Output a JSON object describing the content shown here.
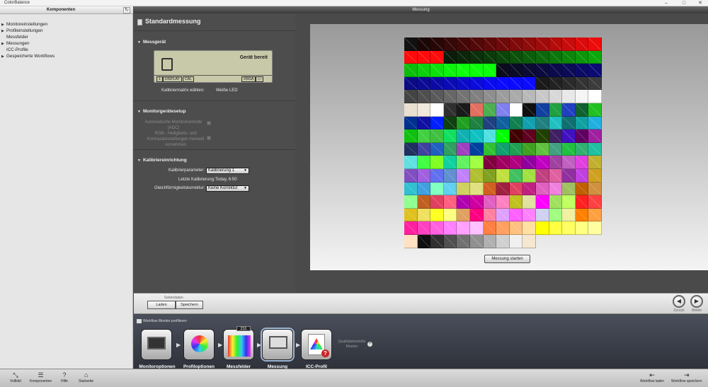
{
  "app": {
    "title": "ColorBalance"
  },
  "window_controls": {
    "minimize": "–",
    "maximize": "□",
    "close": "✕"
  },
  "sidebar": {
    "header": "Komponenten",
    "refresh_icon": "↻",
    "items": [
      {
        "label": "Monitoreinstellungen",
        "expandable": true
      },
      {
        "label": "Profileinstellungen",
        "expandable": true
      },
      {
        "label": "Messfelder",
        "expandable": false
      },
      {
        "label": "Messungen",
        "expandable": true
      },
      {
        "label": "ICC-Profile",
        "expandable": false
      },
      {
        "label": "Gespeicherte Workflows",
        "expandable": true
      }
    ]
  },
  "main": {
    "strip_title": "Messung"
  },
  "panel": {
    "title": "Standardmessung",
    "messgeraet": {
      "header": "Messgerät",
      "lcd_status": "Gerät bereit",
      "lcd_tags": [
        "1",
        "DISPLAY",
        "CAL",
        "XRGA",
        "▭"
      ],
      "matrix_label": "Kalibriermatrix wählen:",
      "matrix_value": "Weiße LED"
    },
    "setup": {
      "header": "Monitorgerätesetup",
      "auto_label": "Automatische Monitorkontrolle (ADC)",
      "rgb_label": "RGB-, Helligkeits- und Kontrasteinstellungen manuell vornehmen"
    },
    "calib": {
      "header": "Kalibriereinrichtung",
      "param_label": "Kalibrierparameter:",
      "param_value": "Kalibrierung 1",
      "last_label": "Letzte Kalibrierung:",
      "last_value": "Today, 6:50",
      "uniform_label": "Gleichförmigkeitskorrektur:",
      "uniform_value": "Keine Korrektur"
    }
  },
  "preview": {
    "start_button": "Messung starten",
    "patches": [
      "#111111",
      "#1c0707",
      "#280707",
      "#360808",
      "#440808",
      "#520909",
      "#600909",
      "#700a0a",
      "#800a0a",
      "#900b0b",
      "#a00b0b",
      "#b40b0b",
      "#c80b0b",
      "#dc0b0b",
      "#ee0b0b",
      "#ff0b0b",
      "#ff0b0b",
      "#ff0b0b",
      "#0b1c0b",
      "#0b260b",
      "#0b300b",
      "#0b3a0b",
      "#0b440b",
      "#0b500b",
      "#0b5c0b",
      "#0b680b",
      "#0b760b",
      "#0b860b",
      "#0b960b",
      "#0ba80b",
      "#0bbc0b",
      "#0bd00b",
      "#0be20b",
      "#0bf40b",
      "#0bff0b",
      "#0bff0b",
      "#0bff0b",
      "#0b0b1e",
      "#0b0b28",
      "#0b0b34",
      "#0b0b40",
      "#0b0b4c",
      "#0b0b58",
      "#0b0b66",
      "#0b0b74",
      "#0b0b84",
      "#0b0b94",
      "#0b0ba4",
      "#0b0bb6",
      "#0b0bc8",
      "#0b0bdc",
      "#0b0bee",
      "#0b0bff",
      "#0b0bff",
      "#0b0bff",
      "#1a1a1a",
      "#222222",
      "#2a2a2a",
      "#333333",
      "#3c3c3c",
      "#444444",
      "#4f4f4f",
      "#5a5a5a",
      "#676767",
      "#737373",
      "#808080",
      "#8e8e8e",
      "#9c9c9c",
      "#aaaaaa",
      "#b8b8b8",
      "#c8c8c8",
      "#d8d8d8",
      "#e8e8e8",
      "#f5f5f5",
      "#ffffff",
      "#eae0d0",
      "#f0e8dc",
      "#ffffff",
      "#303030",
      "#1a1a1a",
      "#e07060",
      "#4caf50",
      "#8080f0",
      "#ffffff",
      "#101010",
      "#1040a0",
      "#20a040",
      "#2040c0",
      "#106030",
      "#20c020",
      "#003090",
      "#1010a0",
      "#0020ff",
      "#104010",
      "#20a020",
      "#208040",
      "#204080",
      "#1060a0",
      "#108050",
      "#10a0b0",
      "#208080",
      "#20c0c0",
      "#107070",
      "#10a0a0",
      "#20b0e0",
      "#10c010",
      "#40d040",
      "#40c040",
      "#10e060",
      "#10b0b0",
      "#10c0c0",
      "#50e0e0",
      "#00ff00",
      "#400000",
      "#600020",
      "#204000",
      "#402060",
      "#4010c0",
      "#600060",
      "#a020a0",
      "#203060",
      "#4040a0",
      "#2060c0",
      "#30a060",
      "#a040c0",
      "#0040a0",
      "#30c030",
      "#10a070",
      "#20a050",
      "#40a020",
      "#60c040",
      "#40a080",
      "#20c040",
      "#30b070",
      "#20c0a0",
      "#60e0e0",
      "#40ff40",
      "#80ff20",
      "#10d0a0",
      "#60f060",
      "#a0ff40",
      "#800040",
      "#a00060",
      "#b00080",
      "#9000a0",
      "#c000c0",
      "#a040a0",
      "#c060c0",
      "#e040e0",
      "#c0b030",
      "#8050c0",
      "#a060e0",
      "#6070f0",
      "#6090d0",
      "#c080ff",
      "#b0c030",
      "#80a020",
      "#c0e040",
      "#40c060",
      "#a0e040",
      "#c04080",
      "#e060a0",
      "#9030a0",
      "#c040e0",
      "#d0a020",
      "#30c0d0",
      "#40a0e0",
      "#80ffc0",
      "#60d0f0",
      "#d0d060",
      "#e0e080",
      "#d06020",
      "#a02040",
      "#e04060",
      "#c02080",
      "#e060c0",
      "#f080e0",
      "#a0c060",
      "#c06000",
      "#d09040",
      "#90ff90",
      "#c06020",
      "#e04060",
      "#ff6080",
      "#b000b0",
      "#d000a0",
      "#e060c0",
      "#ff80c0",
      "#c0c020",
      "#e0e0a0",
      "#ff00ff",
      "#a0e060",
      "#c0ff60",
      "#ff2020",
      "#ff4040",
      "#e0c020",
      "#f0e060",
      "#ffff20",
      "#ffff80",
      "#e0a060",
      "#ff0080",
      "#ff80a0",
      "#e0a0ff",
      "#ff60ff",
      "#ff80ff",
      "#d0d0f0",
      "#a0ff80",
      "#f0f0a0",
      "#ff8000",
      "#ffa040",
      "#ff20a0",
      "#ff40c0",
      "#ff60e0",
      "#ff80ff",
      "#ffa0ff",
      "#ffc0ff",
      "#ff8040",
      "#ffa060",
      "#ffc080",
      "#ffe0a0",
      "#ffff00",
      "#ffff40",
      "#ffff60",
      "#ffff80",
      "#ffffa0",
      "#ffe0c0",
      "#101010",
      "#303030",
      "#505050",
      "#707070",
      "#909090",
      "#b0b0b0",
      "#d0d0d0",
      "#f0f0f0",
      "#f5e6d0"
    ]
  },
  "controls": {
    "section_label": "Seitendaten",
    "load_button": "Laden",
    "save_button": "Speichern",
    "back_label": "Zurück",
    "next_label": "Weiter"
  },
  "workflow": {
    "title": "Workflow Monitor profilieren",
    "steps": [
      {
        "label": "Monitoroptionen",
        "icon": "monitor-options-icon"
      },
      {
        "label": "Profiloptionen",
        "icon": "profile-options-icon"
      },
      {
        "label": "Messfelder",
        "icon": "patches-icon",
        "badge": "211"
      },
      {
        "label": "Messung",
        "icon": "measurement-icon"
      },
      {
        "label": "ICC-Profil",
        "icon": "icc-profile-icon"
      }
    ],
    "extra_label_1": "Qualitätskontrolle",
    "extra_label_2": "Monitor"
  },
  "toolbar": {
    "left": [
      {
        "label": "Vollbild",
        "icon": "⤡"
      },
      {
        "label": "Komponenten",
        "icon": "☰"
      },
      {
        "label": "Hilfe",
        "icon": "?"
      },
      {
        "label": "Startseite",
        "icon": "⌂"
      }
    ],
    "right": [
      {
        "label": "Workflow laden",
        "icon": "⇤"
      },
      {
        "label": "Workflow speichern",
        "icon": "⇥"
      }
    ]
  }
}
